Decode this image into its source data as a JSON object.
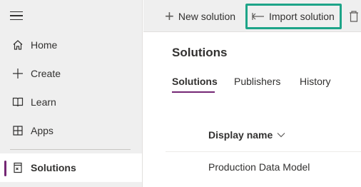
{
  "sidebar": {
    "items": [
      {
        "label": "Home",
        "icon": "home-icon"
      },
      {
        "label": "Create",
        "icon": "plus-icon"
      },
      {
        "label": "Learn",
        "icon": "book-icon"
      },
      {
        "label": "Apps",
        "icon": "apps-icon"
      },
      {
        "label": "Solutions",
        "icon": "solutions-icon",
        "selected": true
      }
    ]
  },
  "commandbar": {
    "new_solution": "New solution",
    "import_solution": "Import solution"
  },
  "main": {
    "title": "Solutions",
    "tabs": [
      "Solutions",
      "Publishers",
      "History"
    ],
    "table": {
      "columns": [
        "Display name"
      ],
      "rows": [
        [
          "Production Data Model"
        ]
      ]
    }
  },
  "colors": {
    "accent": "#742774",
    "highlight": "#1da488",
    "sidebar_bg": "#efefef"
  }
}
